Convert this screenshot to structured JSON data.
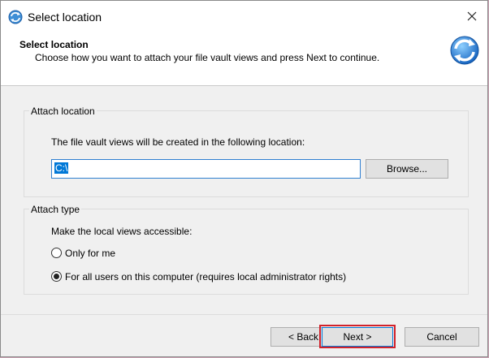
{
  "window": {
    "title": "Select location",
    "close_glyph": "×"
  },
  "header": {
    "title": "Select location",
    "subtitle": "Choose how you want to attach your file vault views and press Next to continue."
  },
  "attach_location": {
    "group_label": "Attach location",
    "description": "The file vault views will be created in the following location:",
    "path_value": "C:\\",
    "browse_label": "Browse..."
  },
  "attach_type": {
    "group_label": "Attach type",
    "description": "Make the local views accessible:",
    "options": [
      {
        "label": "Only for me",
        "selected": false
      },
      {
        "label": "For all users on this computer (requires local administrator rights)",
        "selected": true
      }
    ]
  },
  "footer": {
    "back_label": "< Back",
    "next_label": "Next >",
    "cancel_label": "Cancel"
  },
  "colors": {
    "selection": "#0078d7",
    "highlight_border": "#d1222b",
    "accent": "#2f7fd0"
  },
  "icons": [
    "app-icon",
    "close-icon",
    "sync-icon"
  ]
}
